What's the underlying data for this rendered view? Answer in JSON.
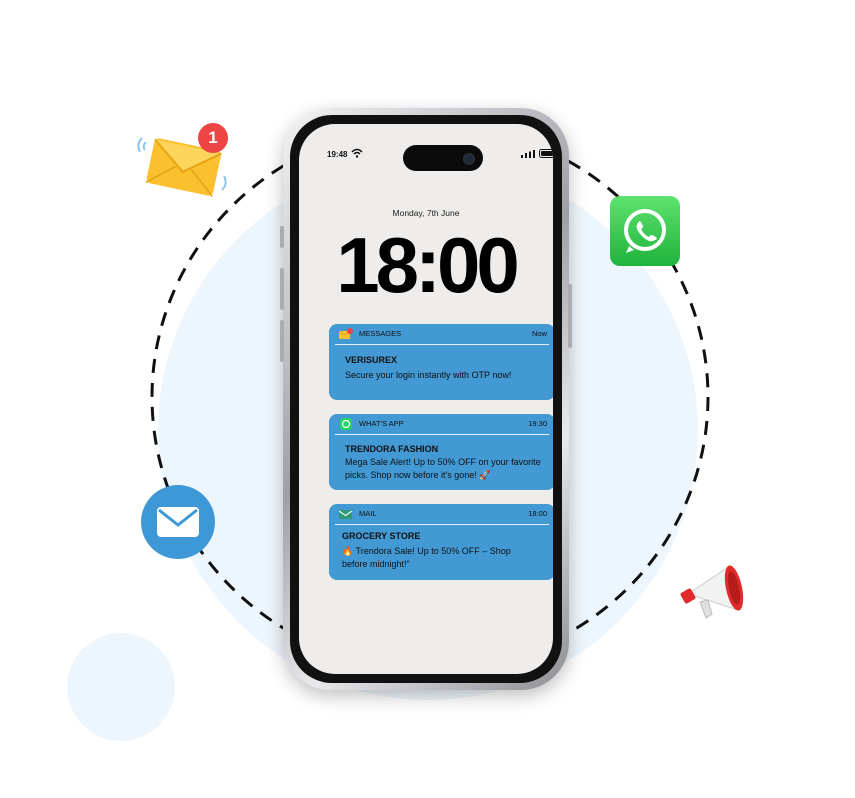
{
  "phone": {
    "status_time": "19:48",
    "date": "Monday, 7th June",
    "clock": "18:00"
  },
  "notifications": [
    {
      "app": "MESSAGES",
      "time": "Now",
      "title": "VERISUREX",
      "body": "Secure your login instantly with OTP now!",
      "icon": "message-envelope-icon"
    },
    {
      "app": "WHAT'S APP",
      "time": "19:30",
      "title": "TRENDORA FASHION",
      "body": "Mega Sale Alert! Up to 50% OFF on your favorite picks. Shop now before it's gone! 🚀",
      "icon": "whatsapp-icon"
    },
    {
      "app": "MAIL",
      "time": "18:00",
      "title": "GROCERY STORE",
      "body": "🔥 Trendora Sale! Up to 50% OFF – Shop before midnight!\"",
      "icon": "mail-icon"
    }
  ],
  "decor": {
    "email_badge_count": "1",
    "accent_blue": "#4299d4",
    "whatsapp_green": "#25d366",
    "envelope_yellow": "#fbc02d",
    "badge_red": "#ef4444",
    "icons": [
      "envelope-notification-icon",
      "whatsapp-icon",
      "mail-circle-icon",
      "megaphone-icon"
    ]
  }
}
